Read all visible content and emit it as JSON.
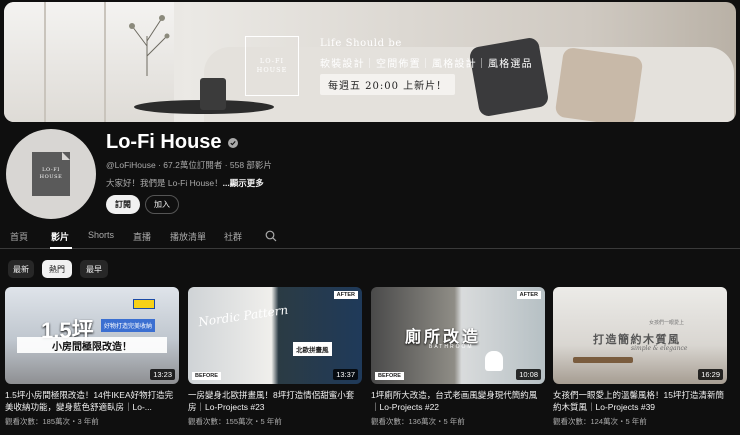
{
  "banner": {
    "logo_line1": "LO-FI",
    "logo_line2": "HOUSE",
    "tagline": "Life Should be",
    "subline": "軟裝設計｜空間佈置｜風格設計｜風格選品",
    "schedule": "每週五 20:00 上新片！"
  },
  "channel": {
    "avatar_line1": "LO-FI",
    "avatar_line2": "HOUSE",
    "name": "Lo-Fi House",
    "meta": "@LoFiHouse · 67.2萬位訂閱者 · 558 部影片",
    "description": "大家好！我們是 Lo-Fi House！",
    "more_link": "...顯示更多",
    "subscribe_label": "訂閱",
    "join_label": "加入"
  },
  "tabs": [
    {
      "label": "首頁"
    },
    {
      "label": "影片"
    },
    {
      "label": "Shorts"
    },
    {
      "label": "直播"
    },
    {
      "label": "播放清單"
    },
    {
      "label": "社群"
    }
  ],
  "chips": [
    {
      "label": "最新"
    },
    {
      "label": "熱門"
    },
    {
      "label": "最早"
    }
  ],
  "videos": [
    {
      "title": "1.5坪小房間極限改造！14件IKEA好物打造完美收納功能，變身藍色舒適臥房｜Lo-...",
      "meta": "觀看次數：185萬次・3 年前",
      "duration": "13:23",
      "thumb_big": "1.5坪",
      "thumb_badge": "好物打造完美收納",
      "thumb_band": "小房間極限改造！"
    },
    {
      "title": "一房變身北歐拼畫風！8坪打造情侶甜蜜小套房｜Lo-Projects #23",
      "meta": "觀看次數：155萬次・5 年前",
      "duration": "13:37",
      "thumb_script": "Nordic Pattern",
      "thumb_label": "北歐拼畫風",
      "thumb_before": "BEFORE",
      "thumb_after": "AFTER"
    },
    {
      "title": "1坪廁所大改造，台式老画風變身現代簡約風｜Lo-Projects #22",
      "meta": "觀看次數：136萬次・5 年前",
      "duration": "10:08",
      "thumb_big": "廁所改造",
      "thumb_sub": "BATHROOM",
      "thumb_before": "BEFORE",
      "thumb_after": "AFTER"
    },
    {
      "title": "女孩們一眼愛上的溫馨風格！15坪打造清新簡約木質風｜Lo-Projects #39",
      "meta": "觀看次數：124萬次・5 年前",
      "duration": "16:29",
      "thumb_big": "打造簡約木質風",
      "thumb_sub": "simple & elegance",
      "thumb_small": "女孩們一眼愛上"
    }
  ],
  "colors": {
    "background": "#0f0f0f",
    "text_primary": "#f1f1f1",
    "text_secondary": "#aaaaaa",
    "chip_bg": "#272727"
  }
}
